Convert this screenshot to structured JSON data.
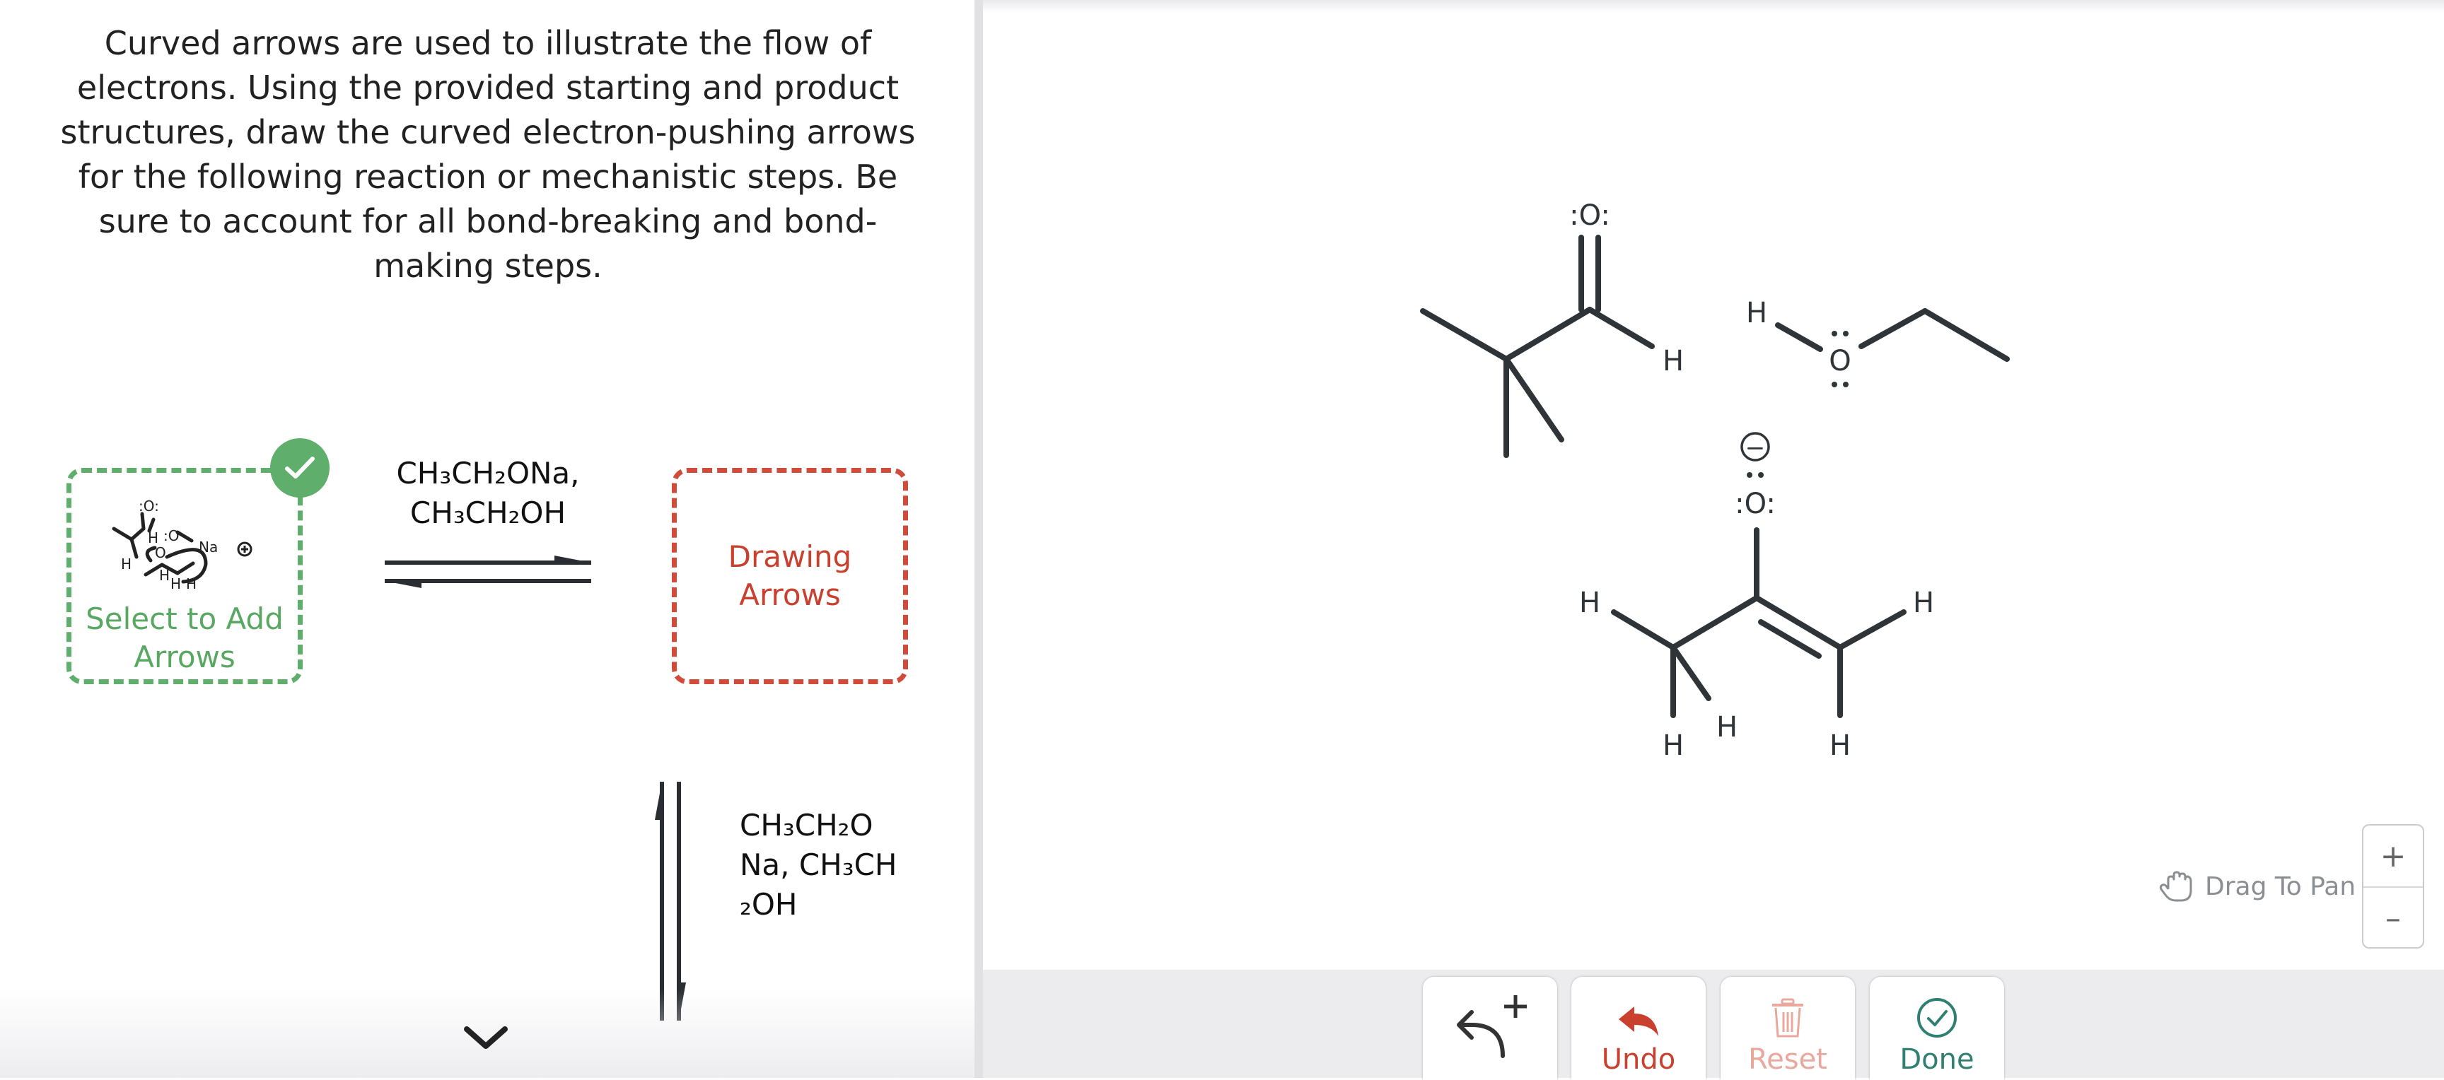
{
  "instructions": "Curved arrows are used to illustrate the flow of electrons. Using the provided starting and product structures, draw the curved electron-pushing arrows for the following reaction or mechanistic steps. Be sure to account for all bond-breaking and bond-making steps.",
  "start_card": {
    "label": "Select to Add Arrows",
    "status": "complete",
    "accent_color": "#5fae6b"
  },
  "drawing_card": {
    "label": "Drawing Arrows",
    "accent_color": "#d04b3a"
  },
  "reagents_horizontal": {
    "line1": "CH₃CH₂ONa,",
    "line2": "CH₃CH₂OH"
  },
  "reagents_vertical": {
    "line1": "CH₃CH₂O",
    "line2": "Na, CH₃CH",
    "line3": "₂OH"
  },
  "canvas": {
    "atoms": {
      "aldehyde_O": ":O:",
      "aldehyde_H": "H",
      "ethanol_H": "H",
      "ethanol_O": "O",
      "enolate_charge": "−",
      "enolate_O": ":O:",
      "enolate_H_left": "H",
      "enolate_H_bottom1": "H",
      "enolate_H_bottom2": "H",
      "enolate_H_bottom3": "H",
      "enolate_H_right": "H"
    },
    "drag_to_pan": "Drag To Pan",
    "zoom_in": "+",
    "zoom_out": "–"
  },
  "toolbar": {
    "add_arrow_icon": "curved-arrow-plus-icon",
    "undo": "Undo",
    "reset": "Reset",
    "done": "Done"
  }
}
